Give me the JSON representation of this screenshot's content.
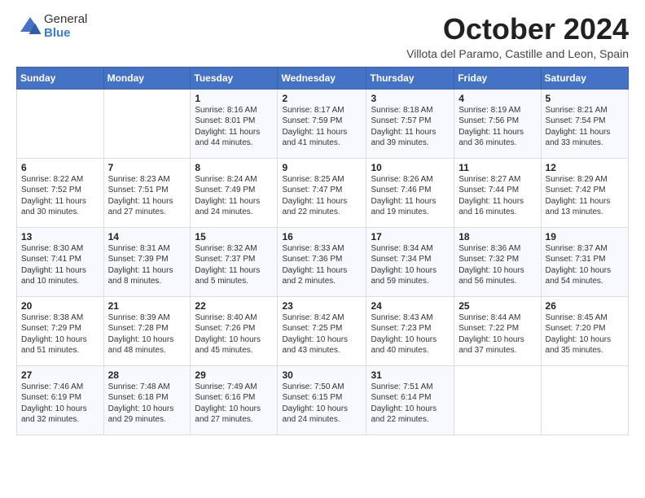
{
  "logo": {
    "general": "General",
    "blue": "Blue"
  },
  "header": {
    "month": "October 2024",
    "location": "Villota del Paramo, Castille and Leon, Spain"
  },
  "weekdays": [
    "Sunday",
    "Monday",
    "Tuesday",
    "Wednesday",
    "Thursday",
    "Friday",
    "Saturday"
  ],
  "weeks": [
    [
      {
        "day": "",
        "content": ""
      },
      {
        "day": "",
        "content": ""
      },
      {
        "day": "1",
        "content": "Sunrise: 8:16 AM\nSunset: 8:01 PM\nDaylight: 11 hours and 44 minutes."
      },
      {
        "day": "2",
        "content": "Sunrise: 8:17 AM\nSunset: 7:59 PM\nDaylight: 11 hours and 41 minutes."
      },
      {
        "day": "3",
        "content": "Sunrise: 8:18 AM\nSunset: 7:57 PM\nDaylight: 11 hours and 39 minutes."
      },
      {
        "day": "4",
        "content": "Sunrise: 8:19 AM\nSunset: 7:56 PM\nDaylight: 11 hours and 36 minutes."
      },
      {
        "day": "5",
        "content": "Sunrise: 8:21 AM\nSunset: 7:54 PM\nDaylight: 11 hours and 33 minutes."
      }
    ],
    [
      {
        "day": "6",
        "content": "Sunrise: 8:22 AM\nSunset: 7:52 PM\nDaylight: 11 hours and 30 minutes."
      },
      {
        "day": "7",
        "content": "Sunrise: 8:23 AM\nSunset: 7:51 PM\nDaylight: 11 hours and 27 minutes."
      },
      {
        "day": "8",
        "content": "Sunrise: 8:24 AM\nSunset: 7:49 PM\nDaylight: 11 hours and 24 minutes."
      },
      {
        "day": "9",
        "content": "Sunrise: 8:25 AM\nSunset: 7:47 PM\nDaylight: 11 hours and 22 minutes."
      },
      {
        "day": "10",
        "content": "Sunrise: 8:26 AM\nSunset: 7:46 PM\nDaylight: 11 hours and 19 minutes."
      },
      {
        "day": "11",
        "content": "Sunrise: 8:27 AM\nSunset: 7:44 PM\nDaylight: 11 hours and 16 minutes."
      },
      {
        "day": "12",
        "content": "Sunrise: 8:29 AM\nSunset: 7:42 PM\nDaylight: 11 hours and 13 minutes."
      }
    ],
    [
      {
        "day": "13",
        "content": "Sunrise: 8:30 AM\nSunset: 7:41 PM\nDaylight: 11 hours and 10 minutes."
      },
      {
        "day": "14",
        "content": "Sunrise: 8:31 AM\nSunset: 7:39 PM\nDaylight: 11 hours and 8 minutes."
      },
      {
        "day": "15",
        "content": "Sunrise: 8:32 AM\nSunset: 7:37 PM\nDaylight: 11 hours and 5 minutes."
      },
      {
        "day": "16",
        "content": "Sunrise: 8:33 AM\nSunset: 7:36 PM\nDaylight: 11 hours and 2 minutes."
      },
      {
        "day": "17",
        "content": "Sunrise: 8:34 AM\nSunset: 7:34 PM\nDaylight: 10 hours and 59 minutes."
      },
      {
        "day": "18",
        "content": "Sunrise: 8:36 AM\nSunset: 7:32 PM\nDaylight: 10 hours and 56 minutes."
      },
      {
        "day": "19",
        "content": "Sunrise: 8:37 AM\nSunset: 7:31 PM\nDaylight: 10 hours and 54 minutes."
      }
    ],
    [
      {
        "day": "20",
        "content": "Sunrise: 8:38 AM\nSunset: 7:29 PM\nDaylight: 10 hours and 51 minutes."
      },
      {
        "day": "21",
        "content": "Sunrise: 8:39 AM\nSunset: 7:28 PM\nDaylight: 10 hours and 48 minutes."
      },
      {
        "day": "22",
        "content": "Sunrise: 8:40 AM\nSunset: 7:26 PM\nDaylight: 10 hours and 45 minutes."
      },
      {
        "day": "23",
        "content": "Sunrise: 8:42 AM\nSunset: 7:25 PM\nDaylight: 10 hours and 43 minutes."
      },
      {
        "day": "24",
        "content": "Sunrise: 8:43 AM\nSunset: 7:23 PM\nDaylight: 10 hours and 40 minutes."
      },
      {
        "day": "25",
        "content": "Sunrise: 8:44 AM\nSunset: 7:22 PM\nDaylight: 10 hours and 37 minutes."
      },
      {
        "day": "26",
        "content": "Sunrise: 8:45 AM\nSunset: 7:20 PM\nDaylight: 10 hours and 35 minutes."
      }
    ],
    [
      {
        "day": "27",
        "content": "Sunrise: 7:46 AM\nSunset: 6:19 PM\nDaylight: 10 hours and 32 minutes."
      },
      {
        "day": "28",
        "content": "Sunrise: 7:48 AM\nSunset: 6:18 PM\nDaylight: 10 hours and 29 minutes."
      },
      {
        "day": "29",
        "content": "Sunrise: 7:49 AM\nSunset: 6:16 PM\nDaylight: 10 hours and 27 minutes."
      },
      {
        "day": "30",
        "content": "Sunrise: 7:50 AM\nSunset: 6:15 PM\nDaylight: 10 hours and 24 minutes."
      },
      {
        "day": "31",
        "content": "Sunrise: 7:51 AM\nSunset: 6:14 PM\nDaylight: 10 hours and 22 minutes."
      },
      {
        "day": "",
        "content": ""
      },
      {
        "day": "",
        "content": ""
      }
    ]
  ]
}
